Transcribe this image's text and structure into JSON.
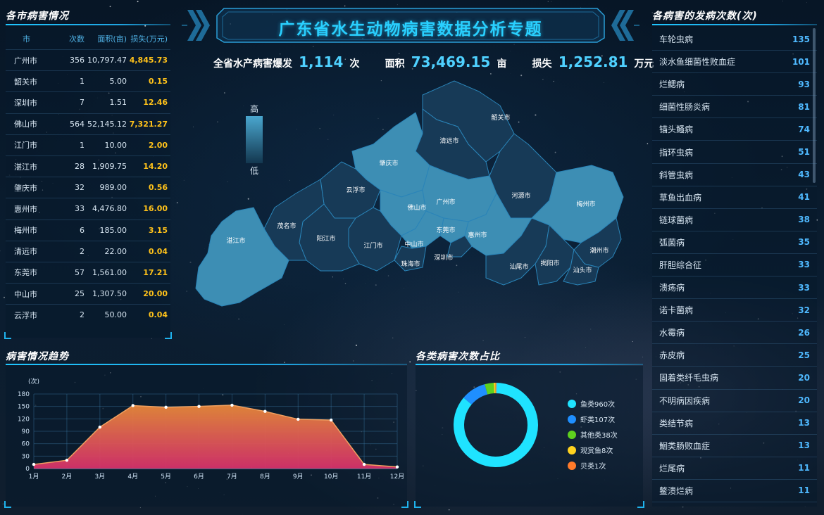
{
  "header": {
    "title": "广东省水生动物病害数据分析专题"
  },
  "summary": {
    "outbreak_label": "全省水产病害爆发",
    "outbreak_value": "1,114",
    "outbreak_unit": "次",
    "area_label": "面积",
    "area_value": "73,469.15",
    "area_unit": "亩",
    "loss_label": "损失",
    "loss_value": "1,252.81",
    "loss_unit": "万元"
  },
  "legend": {
    "high": "高",
    "low": "低"
  },
  "city_table": {
    "title": "各市病害情况",
    "headers": [
      "市",
      "次数",
      "面积(亩)",
      "损失(万元)"
    ],
    "rows": [
      {
        "city": "广州市",
        "count": "356",
        "area": "10,797.47",
        "loss": "4,845.73"
      },
      {
        "city": "韶关市",
        "count": "1",
        "area": "5.00",
        "loss": "0.15"
      },
      {
        "city": "深圳市",
        "count": "7",
        "area": "1.51",
        "loss": "12.46"
      },
      {
        "city": "佛山市",
        "count": "564",
        "area": "52,145.12",
        "loss": "7,321.27"
      },
      {
        "city": "江门市",
        "count": "1",
        "area": "10.00",
        "loss": "2.00"
      },
      {
        "city": "湛江市",
        "count": "28",
        "area": "1,909.75",
        "loss": "14.20"
      },
      {
        "city": "肇庆市",
        "count": "32",
        "area": "989.00",
        "loss": "0.56"
      },
      {
        "city": "惠州市",
        "count": "33",
        "area": "4,476.80",
        "loss": "16.00"
      },
      {
        "city": "梅州市",
        "count": "6",
        "area": "185.00",
        "loss": "3.15"
      },
      {
        "city": "清远市",
        "count": "2",
        "area": "22.00",
        "loss": "0.04"
      },
      {
        "city": "东莞市",
        "count": "57",
        "area": "1,561.00",
        "loss": "17.21"
      },
      {
        "city": "中山市",
        "count": "25",
        "area": "1,307.50",
        "loss": "20.00"
      },
      {
        "city": "云浮市",
        "count": "2",
        "area": "50.00",
        "loss": "0.04"
      }
    ]
  },
  "map_labels": [
    "韶关市",
    "清远市",
    "肇庆市",
    "云浮市",
    "广州市",
    "佛山市",
    "河源市",
    "梅州市",
    "茂名市",
    "阳江市",
    "江门市",
    "东莞市",
    "惠州市",
    "中山市",
    "湛江市",
    "深圳市",
    "珠海市",
    "汕尾市",
    "揭阳市",
    "潮州市",
    "汕头市"
  ],
  "disease_list": {
    "title": "各病害的发病次数(次)",
    "items": [
      {
        "name": "车轮虫病",
        "count": "135"
      },
      {
        "name": "淡水鱼细菌性败血症",
        "count": "101"
      },
      {
        "name": "烂鳃病",
        "count": "93"
      },
      {
        "name": "细菌性肠炎病",
        "count": "81"
      },
      {
        "name": "锚头鳋病",
        "count": "74"
      },
      {
        "name": "指环虫病",
        "count": "51"
      },
      {
        "name": "斜管虫病",
        "count": "43"
      },
      {
        "name": "草鱼出血病",
        "count": "41"
      },
      {
        "name": "链球菌病",
        "count": "38"
      },
      {
        "name": "弧菌病",
        "count": "35"
      },
      {
        "name": "肝胆综合征",
        "count": "33"
      },
      {
        "name": "溃疡病",
        "count": "33"
      },
      {
        "name": "诺卡菌病",
        "count": "32"
      },
      {
        "name": "水霉病",
        "count": "26"
      },
      {
        "name": "赤皮病",
        "count": "25"
      },
      {
        "name": "固着类纤毛虫病",
        "count": "20"
      },
      {
        "name": "不明病因疾病",
        "count": "20"
      },
      {
        "name": "类结节病",
        "count": "13"
      },
      {
        "name": "鮰类肠败血症",
        "count": "13"
      },
      {
        "name": "烂尾病",
        "count": "11"
      },
      {
        "name": "鳖溃烂病",
        "count": "11"
      }
    ]
  },
  "trend": {
    "title": "病害情况趋势"
  },
  "pie": {
    "title": "各类病害次数占比"
  },
  "chart_data": [
    {
      "type": "area",
      "title": "病害情况趋势",
      "ylabel": "(次)",
      "categories": [
        "1月",
        "2月",
        "3月",
        "4月",
        "5月",
        "6月",
        "7月",
        "8月",
        "9月",
        "10月",
        "11月",
        "12月"
      ],
      "values": [
        10,
        20,
        100,
        152,
        148,
        150,
        153,
        138,
        119,
        117,
        10,
        4
      ],
      "ylim": [
        0,
        180
      ],
      "yticks": [
        0,
        30,
        60,
        90,
        120,
        150,
        180
      ],
      "grid": true
    },
    {
      "type": "pie",
      "title": "各类病害次数占比",
      "series": [
        {
          "name": "鱼类",
          "value": 960,
          "label": "960次",
          "color": "#1fe3ff"
        },
        {
          "name": "虾类",
          "value": 107,
          "label": "107次",
          "color": "#1f8fff"
        },
        {
          "name": "其他类",
          "value": 38,
          "label": "38次",
          "color": "#5ed01e"
        },
        {
          "name": "观赏鱼",
          "value": 8,
          "label": "8次",
          "color": "#ffd21f"
        },
        {
          "name": "贝类",
          "value": 1,
          "label": "1次",
          "color": "#ff7a2a"
        }
      ],
      "legend": "right"
    }
  ]
}
